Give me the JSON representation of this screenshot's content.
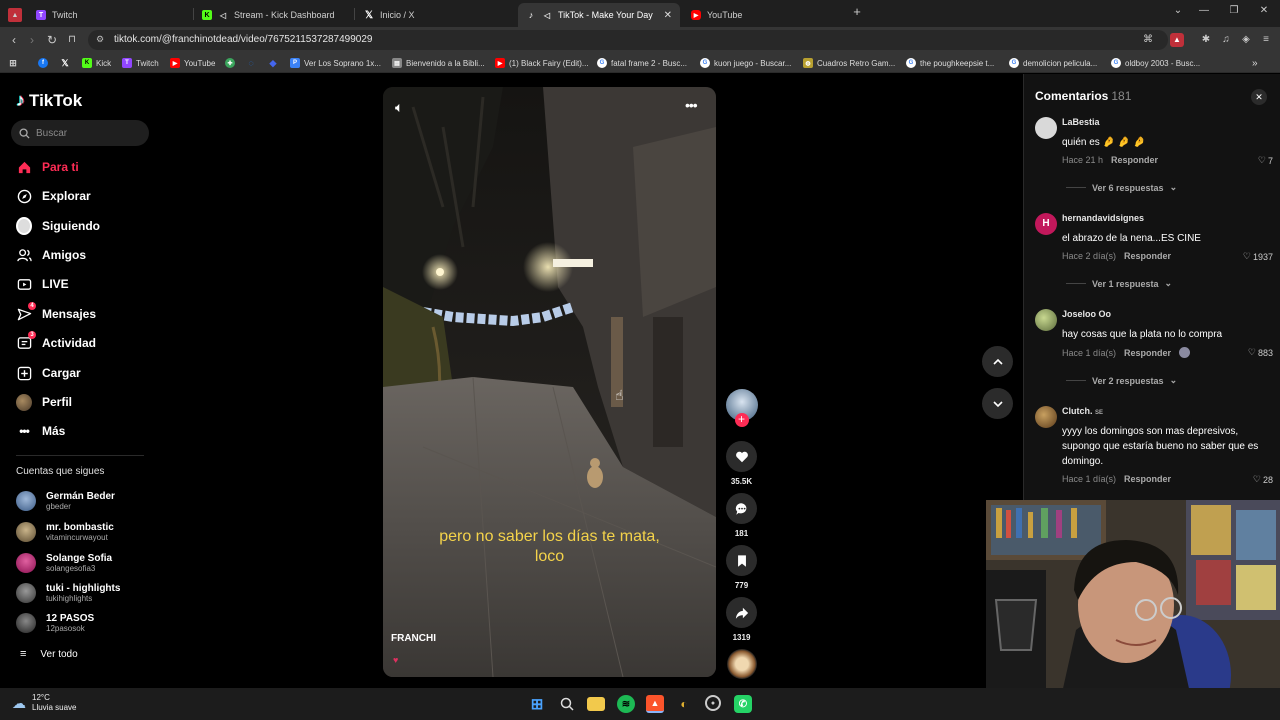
{
  "browser": {
    "tabs": [
      {
        "title": "Twitch",
        "icon": "twitch-icon",
        "color": "#9146ff"
      },
      {
        "title": "Stream - Kick Dashboard",
        "icon": "kick-icon",
        "color": "#53fc18"
      },
      {
        "title": "Inicio / X",
        "icon": "x-icon",
        "color": "#ffffff"
      },
      {
        "title": "TikTok - Make Your Day",
        "icon": "tiktok-icon",
        "color": "#ffffff",
        "active": true
      },
      {
        "title": "YouTube",
        "icon": "youtube-icon",
        "color": "#ff0000"
      }
    ],
    "url": "tiktok.com/@franchinotdead/video/7675211537287499029",
    "bookmarks": [
      {
        "label": "",
        "icon": "apps-icon",
        "color": "#555555"
      },
      {
        "label": "",
        "icon": "facebook-icon",
        "color": "#1877f2"
      },
      {
        "label": "",
        "icon": "x-icon",
        "color": "#000000"
      },
      {
        "label": "Kick",
        "icon": "kick-icon",
        "color": "#53fc18"
      },
      {
        "label": "Twitch",
        "icon": "twitch-icon",
        "color": "#9146ff"
      },
      {
        "label": "YouTube",
        "icon": "youtube-icon",
        "color": "#ff0000"
      },
      {
        "label": "",
        "icon": "green-icon",
        "color": "#3ba55d"
      },
      {
        "label": "",
        "icon": "blue-icon",
        "color": "#1a73e8"
      },
      {
        "label": "",
        "icon": "blue2-icon",
        "color": "#4466ee"
      },
      {
        "label": "Ver Los Soprano 1x...",
        "icon": "p-icon",
        "color": "#3b82f6"
      },
      {
        "label": "Bienvenido a la Bibli...",
        "icon": "doc-icon",
        "color": "#888888"
      },
      {
        "label": "(1) Black Fairy (Edit)...",
        "icon": "youtube-icon",
        "color": "#ff0000"
      },
      {
        "label": "fatal frame 2 - Busc...",
        "icon": "google-icon",
        "color": "#ffffff"
      },
      {
        "label": "kuon juego - Buscar...",
        "icon": "google-icon",
        "color": "#ffffff"
      },
      {
        "label": "Cuadros Retro Gam...",
        "icon": "shop-icon",
        "color": "#b8a030"
      },
      {
        "label": "the poughkeepsie t...",
        "icon": "google-icon",
        "color": "#ffffff"
      },
      {
        "label": "demolicion pelicula...",
        "icon": "google-icon",
        "color": "#ffffff"
      },
      {
        "label": "oldboy 2003 - Busc...",
        "icon": "google-icon",
        "color": "#ffffff"
      }
    ]
  },
  "sidebar": {
    "logo": "TikTok",
    "search_placeholder": "Buscar",
    "nav": [
      {
        "label": "Para ti",
        "icon": "home-icon",
        "active": true,
        "badge": ""
      },
      {
        "label": "Explorar",
        "icon": "compass-icon",
        "badge": ""
      },
      {
        "label": "Siguiendo",
        "icon": "following-icon",
        "badge": ""
      },
      {
        "label": "Amigos",
        "icon": "friends-icon",
        "badge": ""
      },
      {
        "label": "LIVE",
        "icon": "live-icon",
        "badge": ""
      },
      {
        "label": "Mensajes",
        "icon": "message-icon",
        "badge": "4"
      },
      {
        "label": "Actividad",
        "icon": "activity-icon",
        "badge": "3"
      },
      {
        "label": "Cargar",
        "icon": "upload-icon",
        "badge": ""
      },
      {
        "label": "Perfil",
        "icon": "profile-icon",
        "badge": ""
      },
      {
        "label": "Más",
        "icon": "more-icon",
        "badge": ""
      }
    ],
    "following_title": "Cuentas que sigues",
    "following": [
      {
        "name": "Germán Beder",
        "handle": "gbeder",
        "color": "#5b7fa6"
      },
      {
        "name": "mr. bombastic",
        "handle": "vitamincurwayout",
        "color": "#8a7a5a"
      },
      {
        "name": "Solange Sofia",
        "handle": "solangesofia3",
        "color": "#c0307a"
      },
      {
        "name": "tuki - highlights",
        "handle": "tukihighlights",
        "color": "#6a6a6a"
      },
      {
        "name": "12 PASOS",
        "handle": "12pasosok",
        "color": "#444444"
      }
    ],
    "see_all": "Ver todo"
  },
  "video": {
    "caption_line1": "pero no saber los días te mata,",
    "caption_line2": "loco",
    "author": "FRANCHI",
    "caption_color": "#f4d34a"
  },
  "actions": {
    "likes": "35.5K",
    "comments": "181",
    "saves": "779",
    "shares": "1319"
  },
  "comments": {
    "title": "Comentarios",
    "count": "181",
    "reply_label": "Responder",
    "items": [
      {
        "user": "LaBestia",
        "text": "quién es 🤌 🤌 🤌",
        "time": "Hace 21 h",
        "likes": "7",
        "more": "Ver 6 respuestas",
        "avatar_color": "#d9d9d9",
        "avatar_letter": ""
      },
      {
        "user": "hernandavidsignes",
        "text": "el abrazo de la nena...ES CINE",
        "time": "Hace 2 día(s)",
        "likes": "1937",
        "more": "Ver 1 respuesta",
        "avatar_color": "#c2185b",
        "avatar_letter": "H"
      },
      {
        "user": "Joseloo Oo",
        "text": "hay cosas que la plata no lo compra",
        "time": "Hace 1 día(s)",
        "likes": "883",
        "more": "Ver 2 respuestas",
        "avatar_color": "#7a8a4a",
        "avatar_letter": ""
      },
      {
        "user": "Clutch.",
        "user_badge": "SE",
        "text": "yyyy los domingos son mas depresivos, supongo que estaría bueno no saber que es domingo.",
        "time": "Hace 1 día(s)",
        "likes": "28",
        "more": "",
        "avatar_color": "#8a6a3a",
        "avatar_letter": ""
      }
    ]
  },
  "taskbar": {
    "temp": "12°C",
    "weather": "Lluvia suave",
    "apps": [
      {
        "icon": "windows-icon",
        "color": "#4aa3ff"
      },
      {
        "icon": "search-icon",
        "color": "#dddddd"
      },
      {
        "icon": "folder-icon",
        "color": "#f2c94c"
      },
      {
        "icon": "spotify-icon",
        "color": "#1db954"
      },
      {
        "icon": "brave-icon",
        "color": "#fb542b"
      },
      {
        "icon": "app-icon",
        "color": "#e0b030"
      },
      {
        "icon": "obs-icon",
        "color": "#cccccc"
      },
      {
        "icon": "whatsapp-icon",
        "color": "#25d366"
      }
    ]
  }
}
